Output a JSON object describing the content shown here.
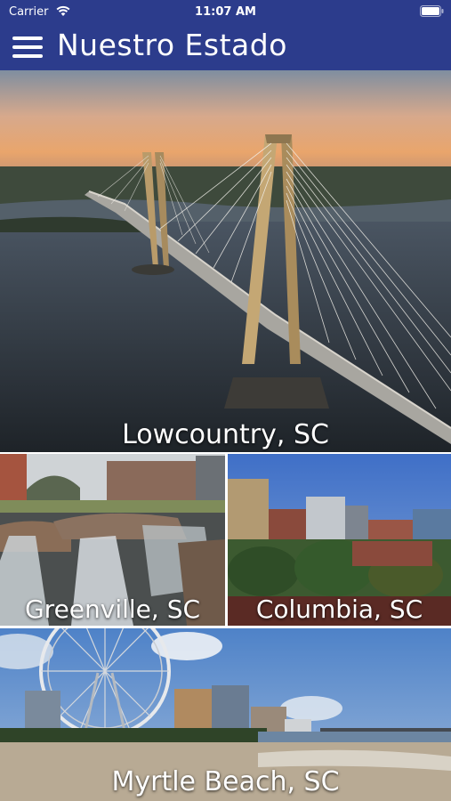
{
  "status_bar": {
    "carrier": "Carrier",
    "time": "11:07 AM"
  },
  "header": {
    "title": "Nuestro Estado",
    "menu_icon": "hamburger-menu-icon",
    "background_color": "#2c3c8c"
  },
  "regions": [
    {
      "label": "Lowcountry, SC"
    },
    {
      "label": "Greenville, SC"
    },
    {
      "label": "Columbia, SC"
    },
    {
      "label": "Myrtle Beach, SC"
    }
  ]
}
